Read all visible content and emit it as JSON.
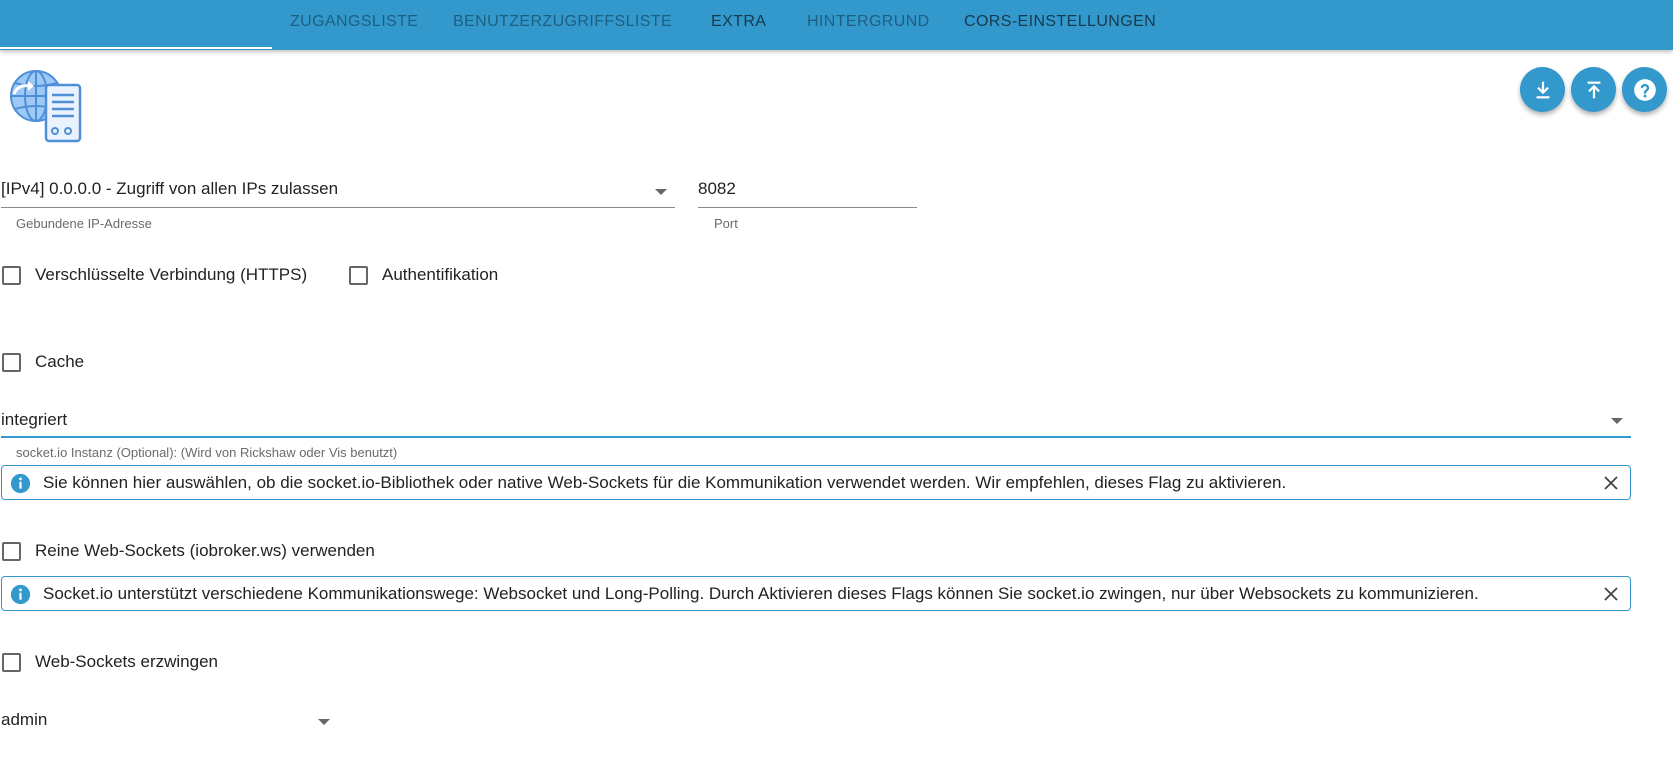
{
  "tabs": [
    {
      "label": "Zugangsliste",
      "state": "muted"
    },
    {
      "label": "Benutzerzugriffsliste",
      "state": "muted"
    },
    {
      "label": "Extra",
      "state": "active"
    },
    {
      "label": "Hintergrund",
      "state": "muted"
    },
    {
      "label": "CORS-Einstellungen",
      "state": "active"
    }
  ],
  "icons": {
    "logo": "globe-server-icon",
    "fab_download": "download-icon",
    "fab_upload": "upload-icon",
    "fab_help": "help-icon",
    "alert_info": "info-icon",
    "alert_close": "close-icon",
    "dropdown": "chevron-down-icon"
  },
  "colors": {
    "primary": "#3399cc",
    "tab_muted": "#1d5f80",
    "tab_active": "#163a4d",
    "text": "#222222",
    "helper_text": "#6b6b6b"
  },
  "form": {
    "bind_ip": {
      "value": "[IPv4] 0.0.0.0 - Zugriff von allen IPs zulassen",
      "helper": "Gebundene IP-Adresse"
    },
    "port": {
      "value": "8082",
      "helper": "Port"
    },
    "https": {
      "label": "Verschlüsselte Verbindung (HTTPS)",
      "checked": false
    },
    "auth": {
      "label": "Authentifikation",
      "checked": false
    },
    "cache": {
      "label": "Cache",
      "checked": false
    },
    "socketio": {
      "value": "integriert",
      "helper": "socket.io Instanz (Optional): (Wird von Rickshaw oder Vis benutzt)"
    },
    "info_socketio": "Sie können hier auswählen, ob die socket.io-Bibliothek oder native Web-Sockets für die Kommunikation verwendet werden. Wir empfehlen, dieses Flag zu aktivieren.",
    "pure_ws": {
      "label": "Reine Web-Sockets (iobroker.ws) verwenden",
      "checked": false
    },
    "info_force_ws": "Socket.io unterstützt verschiedene Kommunikationswege: Websocket und Long-Polling. Durch Aktivieren dieses Flags können Sie socket.io zwingen, nur über Websockets zu kommunizieren.",
    "force_ws": {
      "label": "Web-Sockets erzwingen",
      "checked": false
    },
    "default_user": {
      "value": "admin"
    }
  }
}
